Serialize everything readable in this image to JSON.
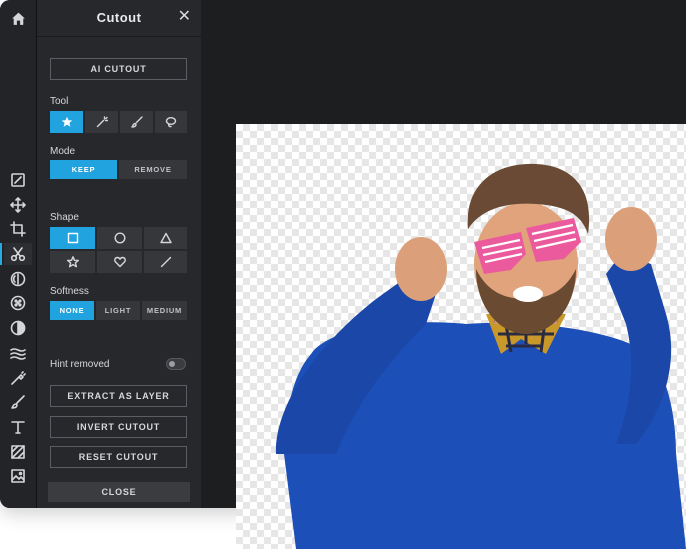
{
  "panel": {
    "title": "Cutout",
    "ai_cutout": "AI CUTOUT",
    "tool_label": "Tool",
    "mode_label": "Mode",
    "mode_options": [
      "KEEP",
      "REMOVE"
    ],
    "shape_label": "Shape",
    "softness_label": "Softness",
    "softness_options": [
      "NONE",
      "LIGHT",
      "MEDIUM"
    ],
    "hint_label": "Hint removed",
    "extract": "EXTRACT AS LAYER",
    "invert": "INVERT CUTOUT",
    "reset": "RESET CUTOUT",
    "close": "CLOSE"
  },
  "state": {
    "selected_tool": "star",
    "selected_mode": "KEEP",
    "selected_shape": "square",
    "selected_softness": "NONE",
    "hint_removed_on": false
  },
  "rail_icons": [
    "home-icon",
    "edit-icon",
    "move-icon",
    "crop-icon",
    "scissors-icon",
    "effects-icon",
    "texture-icon",
    "adjust-icon",
    "wave-icon",
    "retouch-icon",
    "brush-icon",
    "text-icon",
    "pattern-icon",
    "image-icon"
  ],
  "colors": {
    "accent": "#20a3de",
    "bg": "#1d1e20",
    "panel": "#26282b"
  }
}
